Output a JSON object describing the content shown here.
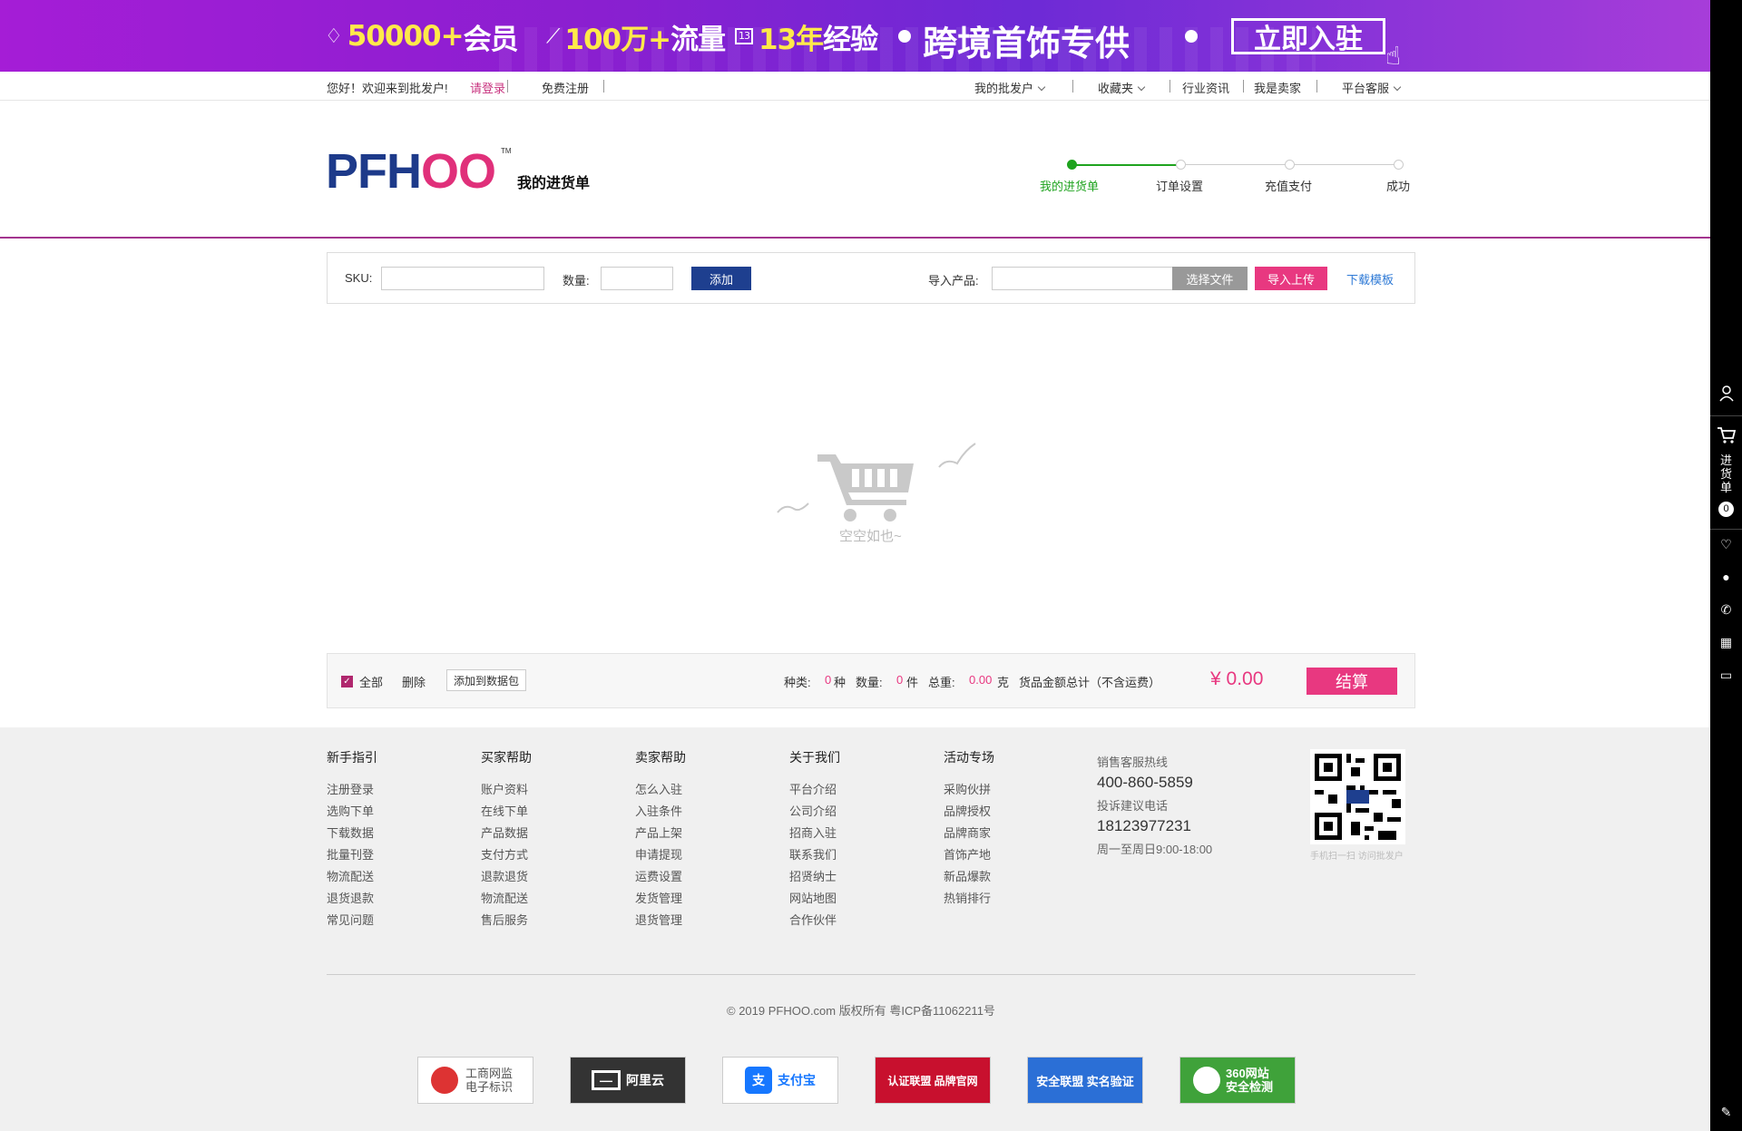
{
  "banner": {
    "members_num": "50000+",
    "members_label": "会员",
    "traffic_num": "100万+",
    "traffic_label": "流量",
    "years_num": "13年",
    "years_label": "经验",
    "calendar_day": "13",
    "slogan": "跨境首饰专供",
    "join_button": "立即入驻"
  },
  "topnav": {
    "welcome": "您好！欢迎来到批发户!",
    "login": "请登录",
    "register": "免费注册",
    "my_account": "我的批发户",
    "favorites": "收藏夹",
    "news": "行业资讯",
    "seller": "我是卖家",
    "service": "平台客服"
  },
  "header": {
    "logo_text": "PFH",
    "logo_oo": "OO",
    "logo_tm": "TM",
    "title": "我的进货单",
    "steps": [
      {
        "label": "我的进货单",
        "active": true
      },
      {
        "label": "订单设置",
        "active": false
      },
      {
        "label": "充值支付",
        "active": false
      },
      {
        "label": "成功",
        "active": false
      }
    ]
  },
  "toolbar": {
    "sku_label": "SKU:",
    "sku_value": "",
    "qty_label": "数量:",
    "qty_value": "",
    "add_button": "添加",
    "import_label": "导入产品:",
    "import_value": "",
    "choose_file": "选择文件",
    "upload_button": "导入上传",
    "download_template": "下载模板"
  },
  "empty": {
    "text": "空空如也~"
  },
  "summary": {
    "select_all": "全部",
    "delete": "删除",
    "add_to_pack": "添加到数据包",
    "kinds_label": "种类:",
    "kinds_value": "0",
    "kinds_unit": "种",
    "qty_label": "数量:",
    "qty_value": "0",
    "qty_unit": "件",
    "weight_label": "总重:",
    "weight_value": "0.00",
    "weight_unit": "克",
    "amount_label": "货品金额总计（不含运费）",
    "total": "¥ 0.00",
    "checkout": "结算"
  },
  "footer": {
    "columns": [
      {
        "title": "新手指引",
        "links": [
          "注册登录",
          "选购下单",
          "下载数据",
          "批量刊登",
          "物流配送",
          "退货退款",
          "常见问题"
        ]
      },
      {
        "title": "买家帮助",
        "links": [
          "账户资料",
          "在线下单",
          "产品数据",
          "支付方式",
          "退款退货",
          "物流配送",
          "售后服务"
        ]
      },
      {
        "title": "卖家帮助",
        "links": [
          "怎么入驻",
          "入驻条件",
          "产品上架",
          "申请提现",
          "运费设置",
          "发货管理",
          "退货管理"
        ]
      },
      {
        "title": "关于我们",
        "links": [
          "平台介绍",
          "公司介绍",
          "招商入驻",
          "联系我们",
          "招贤纳士",
          "网站地图",
          "合作伙伴"
        ]
      },
      {
        "title": "活动专场",
        "links": [
          "采购伙拼",
          "品牌授权",
          "品牌商家",
          "首饰产地",
          "新品爆款",
          "热销排行"
        ]
      }
    ],
    "hotline_label": "销售客服热线",
    "hotline": "400-860-5859",
    "complaint_label": "投诉建议电话",
    "complaint": "18123977231",
    "hours": "周一至周日9:00-18:00",
    "qr_caption": "手机扫一扫 访问批发户",
    "copyright": "© 2019 PFHOO.com 版权所有 粤ICP备11062211号",
    "badges": [
      "工商网监 电子标识",
      "阿里云",
      "支付宝",
      "认证联盟 品牌官网",
      "安全联盟 实名验证",
      "360网站 安全检测"
    ]
  },
  "rail": {
    "cart_label": "进货单",
    "cart_count": "0"
  },
  "colors": {
    "brand_pink": "#e83880",
    "brand_navy": "#1e3f8f",
    "step_green": "#1fa31f",
    "banner_purple": "#8a1fd0"
  }
}
